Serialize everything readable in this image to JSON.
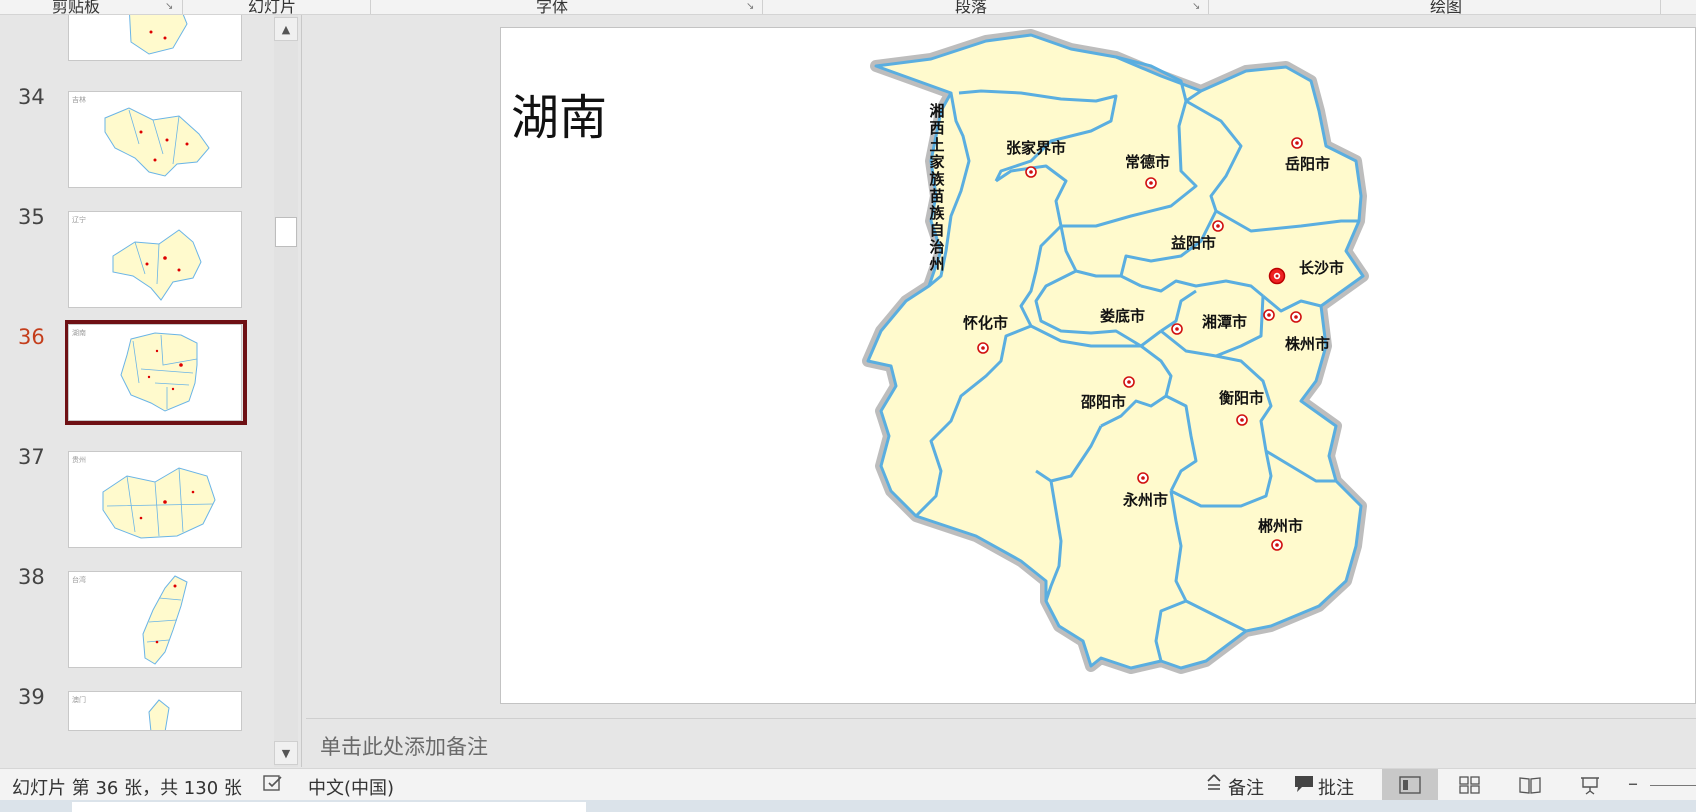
{
  "ribbon": {
    "groups": [
      "剪贴板",
      "幻灯片",
      "字体",
      "段落",
      "绘图"
    ]
  },
  "thumbnails": [
    {
      "num": "34",
      "label": "吉林"
    },
    {
      "num": "35",
      "label": "辽宁"
    },
    {
      "num": "36",
      "label": "湖南",
      "selected": true
    },
    {
      "num": "37",
      "label": "贵州"
    },
    {
      "num": "38",
      "label": "台湾"
    },
    {
      "num": "39",
      "label": "澳门"
    }
  ],
  "slide": {
    "title": "湖南",
    "cities": [
      {
        "label": "湘西土家族苗族自治州",
        "vertical": true
      },
      {
        "label": "张家界市"
      },
      {
        "label": "常德市"
      },
      {
        "label": "岳阳市"
      },
      {
        "label": "益阳市"
      },
      {
        "label": "长沙市",
        "capital": true
      },
      {
        "label": "怀化市"
      },
      {
        "label": "娄底市"
      },
      {
        "label": "湘潭市"
      },
      {
        "label": "株州市"
      },
      {
        "label": "邵阳市"
      },
      {
        "label": "衡阳市"
      },
      {
        "label": "永州市"
      },
      {
        "label": "郴州市"
      }
    ]
  },
  "notes": {
    "placeholder": "单击此处添加备注"
  },
  "status": {
    "slide_info": "幻灯片 第 36 张，共 130 张",
    "language": "中文(中国)",
    "notes_label": "备注",
    "comments_label": "批注"
  },
  "colors": {
    "map_fill": "#fffacd",
    "map_border": "#5aaee0",
    "map_halo": "#bdbdbd",
    "selected_border": "#6e1014",
    "active_num": "#c43e1c"
  },
  "icons": [
    "scroll-up-icon",
    "scroll-down-icon",
    "notes-icon",
    "comments-icon",
    "normal-view-icon",
    "sorter-view-icon",
    "reading-view-icon",
    "slideshow-icon",
    "zoom-out-icon",
    "spellcheck-icon",
    "dialog-launcher-icon"
  ]
}
